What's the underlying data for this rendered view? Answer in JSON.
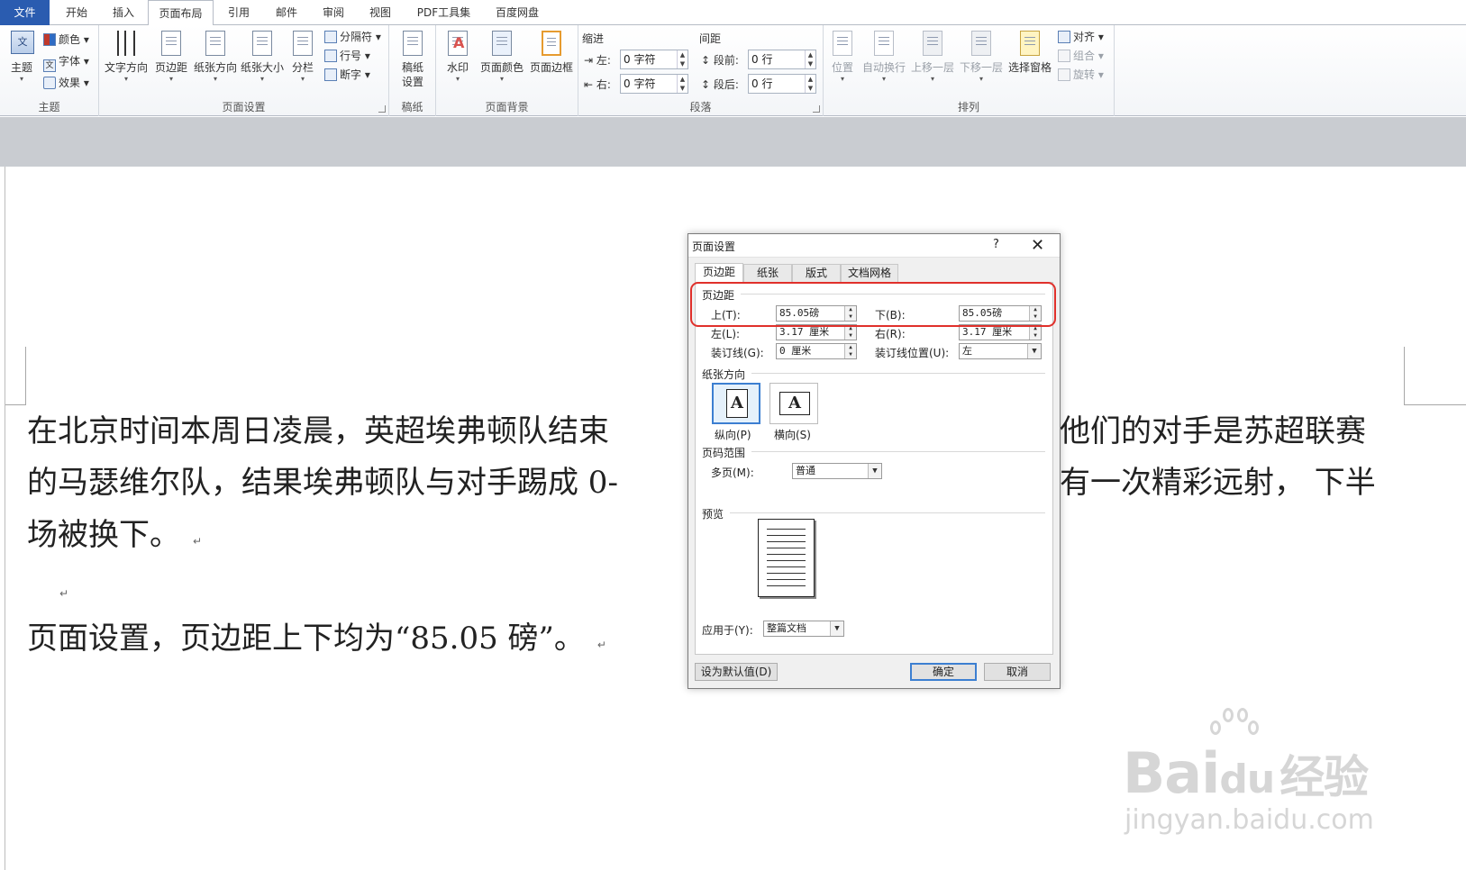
{
  "tabs": [
    "文件",
    "开始",
    "插入",
    "页面布局",
    "引用",
    "邮件",
    "审阅",
    "视图",
    "PDF工具集",
    "百度网盘"
  ],
  "ribbon": {
    "theme_group": {
      "label": "主题",
      "theme_btn": "主题",
      "colors": "颜色",
      "fonts": "字体",
      "effects": "效果"
    },
    "page_setup_group": {
      "label": "页面设置",
      "text_direction": "文字方向",
      "margins": "页边距",
      "orientation": "纸张方向",
      "size": "纸张大小",
      "columns": "分栏",
      "breaks": "分隔符",
      "line_numbers": "行号",
      "hyphenation": "断字"
    },
    "draft_group": {
      "label": "稿纸",
      "draft_settings_1": "稿纸",
      "draft_settings_2": "设置"
    },
    "background_group": {
      "label": "页面背景",
      "watermark": "水印",
      "page_color": "页面颜色",
      "page_borders": "页面边框"
    },
    "paragraph_group": {
      "label": "段落",
      "indent_header": "缩进",
      "spacing_header": "间距",
      "indent_left_label": "左:",
      "indent_left_value": "0 字符",
      "indent_right_label": "右:",
      "indent_right_value": "0 字符",
      "before_label": "段前:",
      "before_value": "0 行",
      "after_label": "段后:",
      "after_value": "0 行"
    },
    "arrange_group": {
      "label": "排列",
      "position": "位置",
      "wrap_text": "自动换行",
      "bring_forward": "上移一层",
      "send_backward": "下移一层",
      "selection_pane": "选择窗格",
      "align": "对齐",
      "group": "组合",
      "rotate": "旋转"
    }
  },
  "document": {
    "line1_left": "在北京时间本周日凌晨，英超埃弗顿队结束",
    "line1_right": "他们的对手是苏超联赛",
    "line2_left": "的马瑟维尔队，结果埃弗顿队与对手踢成 0-",
    "line2_right": "有一次精彩远射， 下半",
    "line3": "场被换下。",
    "line4": "页面设置，页边距上下均为“85.05 磅”。",
    "para_mark": "↵"
  },
  "dialog": {
    "title": "页面设置",
    "help": "?",
    "close": "✕",
    "tabs": [
      "页边距",
      "纸张",
      "版式",
      "文档网格"
    ],
    "margins_section": "页边距",
    "top_label": "上(T):",
    "top_value": "85.05磅",
    "bottom_label": "下(B):",
    "bottom_value": "85.05磅",
    "left_label": "左(L):",
    "left_value": "3.17 厘米",
    "right_label": "右(R):",
    "right_value": "3.17 厘米",
    "gutter_label": "装订线(G):",
    "gutter_value": "0 厘米",
    "gutter_pos_label": "装订线位置(U):",
    "gutter_pos_value": "左",
    "orientation_section": "纸张方向",
    "portrait": "纵向(P)",
    "landscape": "横向(S)",
    "pages_section": "页码范围",
    "multiple_pages_label": "多页(M):",
    "multiple_pages_value": "普通",
    "preview_section": "预览",
    "apply_to_label": "应用于(Y):",
    "apply_to_value": "整篇文档",
    "set_default": "设为默认值(D)",
    "ok": "确定",
    "cancel": "取消"
  },
  "watermark": {
    "brand": "Bai",
    "brand2": "du",
    "brand_cn": "经验",
    "url": "jingyan.baidu.com"
  }
}
